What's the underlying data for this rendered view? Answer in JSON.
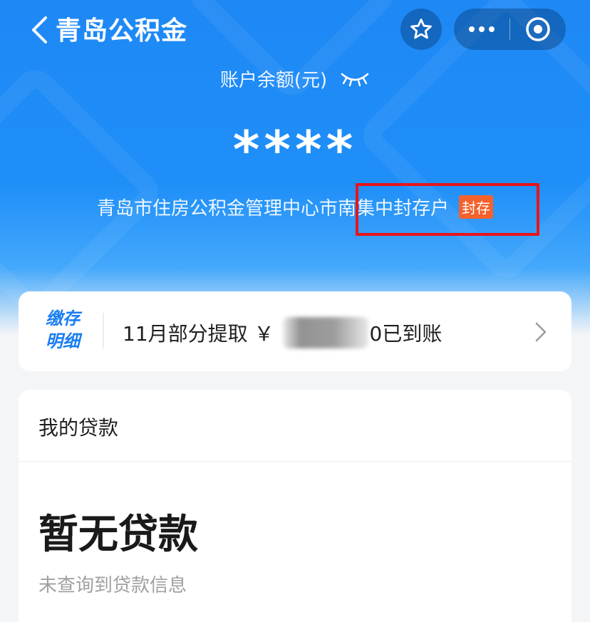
{
  "header": {
    "title": "青岛公积金",
    "back_icon": "chevron-left-icon",
    "favorite_icon": "star-icon",
    "more_icon": "ellipsis-icon",
    "close_icon": "target-circle-icon"
  },
  "balance": {
    "label": "账户余额(元)",
    "visibility_icon": "eye-closed-icon",
    "value": "****"
  },
  "account": {
    "description": "青岛市住房公积金管理中心市南集中封存户",
    "status_badge": "封存",
    "badge_color": "#f5612d"
  },
  "deposit": {
    "logo_line1": "缴存",
    "logo_line2": "明细",
    "text_before": "11月部分提取 ￥",
    "text_after": "0已到账",
    "chevron_icon": "chevron-right-icon"
  },
  "loan": {
    "section_title": "我的贷款",
    "empty_title": "暂无贷款",
    "empty_subtitle": "未查询到贷款信息"
  },
  "colors": {
    "brand_blue": "#1e88f5",
    "highlight_red": "#e8141a"
  }
}
